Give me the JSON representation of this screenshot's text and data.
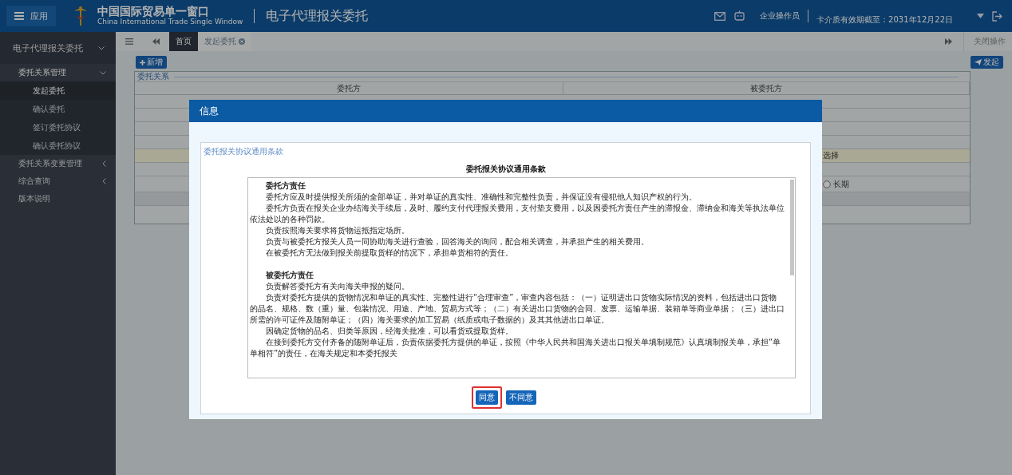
{
  "header": {
    "app_button": "应用",
    "site_title": "中国国际贸易单一窗口",
    "site_subtitle": "China International Trade Single Window",
    "module_title": "电子代理报关委托",
    "user_role": "企业操作员",
    "card_expiry": "卡介质有效期截至：2031年12月22日"
  },
  "sidebar": {
    "title": "电子代理报关委托",
    "expanded": true,
    "items": [
      {
        "label": "委托关系管理",
        "expanded": true,
        "children": [
          {
            "label": "发起委托",
            "selected": true
          },
          {
            "label": "确认委托",
            "selected": false
          },
          {
            "label": "签订委托协议",
            "selected": false
          },
          {
            "label": "确认委托协议",
            "selected": false
          }
        ]
      },
      {
        "label": "委托关系变更管理",
        "expanded": false
      },
      {
        "label": "综合查询",
        "expanded": false
      },
      {
        "label": "版本说明"
      }
    ]
  },
  "tabs": [
    {
      "label": "首页",
      "selected": true,
      "closable": false
    },
    {
      "label": "发起委托",
      "selected": false,
      "closable": true
    }
  ],
  "close_ops": "关闭操作",
  "toolbar": {
    "add_button": "新增",
    "submit_button": "发起"
  },
  "relation_panel": {
    "legend": "委托关系",
    "columns": [
      "委托方",
      "被委托方"
    ],
    "rows": [
      {
        "kind": "plain",
        "text": ""
      },
      {
        "kind": "plain",
        "text": ""
      },
      {
        "kind": "plain",
        "text": ""
      },
      {
        "kind": "plain",
        "text": ""
      },
      {
        "kind": "highlight",
        "text": "选择"
      },
      {
        "kind": "plain",
        "text": ""
      },
      {
        "kind": "radio",
        "text": "长期",
        "checked": false
      },
      {
        "kind": "shaded",
        "text": ""
      }
    ]
  },
  "dialog": {
    "title": "信息",
    "legend": "委托报关协议通用条款",
    "doc_title": "委托报关协议通用条款",
    "sections": [
      {
        "heading": "委托方责任",
        "paragraphs": [
          "委托方应及时提供报关所须的全部单证，并对单证的真实性、准确性和完整性负责，并保证没有侵犯他人知识产权的行为。",
          "委托方负责在报关企业办结海关手续后，及时、履约支付代理报关费用，支付垫支费用，以及因委托方责任产生的滞报金、滞纳金和海关等执法单位依法处以的各种罚款。",
          "负责按照海关要求将货物运抵指定场所。",
          "负责与被委托方报关人员一同协助海关进行查验，回答海关的询问，配合相关调查，并承担产生的相关费用。",
          "在被委托方无法做到报关前提取货样的情况下，承担单货相符的责任。"
        ]
      },
      {
        "heading": "被委托方责任",
        "paragraphs": [
          "负责解答委托方有关向海关申报的疑问。",
          "负责对委托方提供的货物情况和单证的真实性、完整性进行“合理审查”，审查内容包括：（一）证明进出口货物实际情况的资料，包括进出口货物的品名、规格、数（重）量、包装情况、用途、产地、贸易方式等；（二）有关进出口货物的合同、发票、运输单据、装箱单等商业单据；（三）进出口所需的许可证件及随附单证；（四）海关要求的加工贸易（纸质或电子数据的）及其其他进出口单证。",
          "因确定货物的品名、归类等原因，经海关批准，可以看货或提取货样。",
          "在接到委托方交付齐备的随附单证后，负责依据委托方提供的单证，按照《中华人民共和国海关进出口报关单填制规范》认真填制报关单，承担“单单相符”的责任，在海关规定和本委托报关"
        ]
      }
    ],
    "buttons": [
      {
        "label": "同意",
        "highlighted": true
      },
      {
        "label": "不同意",
        "highlighted": false
      }
    ]
  }
}
